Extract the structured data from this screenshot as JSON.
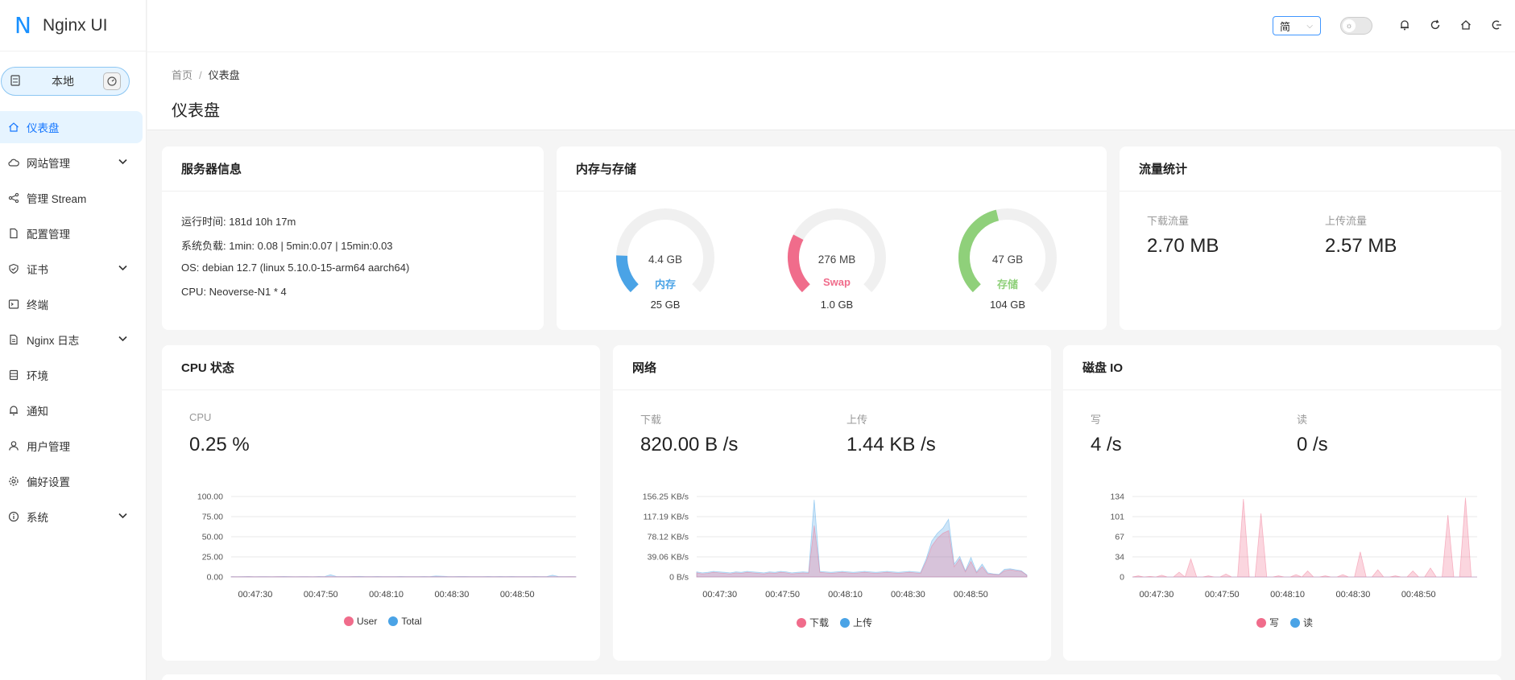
{
  "app": {
    "logo_mark": "N",
    "title": "Nginx UI"
  },
  "environment": {
    "label": "本地"
  },
  "sidebar": {
    "items": [
      {
        "label": "仪表盘",
        "icon": "home-icon",
        "active": true,
        "expandable": false
      },
      {
        "label": "网站管理",
        "icon": "cloud-icon",
        "active": false,
        "expandable": true
      },
      {
        "label": "管理 Stream",
        "icon": "share-icon",
        "active": false,
        "expandable": false
      },
      {
        "label": "配置管理",
        "icon": "file-icon",
        "active": false,
        "expandable": false
      },
      {
        "label": "证书",
        "icon": "shield-check-icon",
        "active": false,
        "expandable": true
      },
      {
        "label": "终端",
        "icon": "terminal-icon",
        "active": false,
        "expandable": false
      },
      {
        "label": "Nginx 日志",
        "icon": "log-file-icon",
        "active": false,
        "expandable": true
      },
      {
        "label": "环境",
        "icon": "database-icon",
        "active": false,
        "expandable": false
      },
      {
        "label": "通知",
        "icon": "bell-icon",
        "active": false,
        "expandable": false
      },
      {
        "label": "用户管理",
        "icon": "user-icon",
        "active": false,
        "expandable": false
      },
      {
        "label": "偏好设置",
        "icon": "gear-icon",
        "active": false,
        "expandable": false
      },
      {
        "label": "系统",
        "icon": "info-circle-icon",
        "active": false,
        "expandable": true
      }
    ]
  },
  "topbar": {
    "language": "简"
  },
  "breadcrumb": {
    "home": "首页",
    "separator": "/",
    "current": "仪表盘"
  },
  "page": {
    "title": "仪表盘"
  },
  "server_info": {
    "title": "服务器信息",
    "uptime": "运行时间: 181d 10h 17m",
    "load": "系统负载: 1min: 0.08 | 5min:0.07 | 15min:0.03",
    "os": "OS: debian 12.7 (linux 5.10.0-15-arm64 aarch64)",
    "cpu": "CPU: Neoverse-N1 * 4"
  },
  "memory_storage": {
    "title": "内存与存储",
    "gauges": [
      {
        "value": "4.4 GB",
        "name": "内存",
        "total": "25 GB",
        "fraction": 0.176,
        "color": "#4aa3e6"
      },
      {
        "value": "276 MB",
        "name": "Swap",
        "total": "1.0 GB",
        "fraction": 0.27,
        "color": "#f06c8b"
      },
      {
        "value": "47 GB",
        "name": "存储",
        "total": "104 GB",
        "fraction": 0.45,
        "color": "#8fd07a"
      }
    ]
  },
  "traffic": {
    "title": "流量统计",
    "download_label": "下载流量",
    "download_value": "2.70 MB",
    "upload_label": "上传流量",
    "upload_value": "2.57 MB"
  },
  "cpu_card": {
    "title": "CPU 状态",
    "label": "CPU",
    "value": "0.25 %"
  },
  "network_card": {
    "title": "网络",
    "down_label": "下载",
    "down_value": "820.00 B /s",
    "up_label": "上传",
    "up_value": "1.44 KB /s"
  },
  "disk_card": {
    "title": "磁盘 IO",
    "write_label": "写",
    "write_value": "4 /s",
    "read_label": "读",
    "read_value": "0 /s"
  },
  "colors": {
    "red_series": "#f06c8b",
    "blue_series": "#4aa3e6",
    "accent": "#1677ff"
  },
  "chart_data": [
    {
      "type": "area",
      "chart": "cpu",
      "x_ticks": [
        "00:47:30",
        "00:47:50",
        "00:48:10",
        "00:48:30",
        "00:48:50"
      ],
      "y_ticks": [
        "100.00",
        "75.00",
        "50.00",
        "25.00",
        "0.00"
      ],
      "ylim": [
        0,
        100
      ],
      "series": [
        {
          "name": "User",
          "color": "#f06c8b",
          "values": [
            0.2,
            0.2,
            0.2,
            0.3,
            0.2,
            0.2,
            0.2,
            0.2,
            0.3,
            0.2,
            0.2,
            0.2,
            0.2,
            0.2,
            0.2,
            0.2,
            0.2,
            0.3,
            0.2,
            0.2,
            0.2,
            0.3,
            0.2,
            0.2,
            0.2,
            0.2,
            0.2,
            0.2,
            0.2,
            0.2,
            0.2,
            0.2,
            0.2,
            0.2,
            0.2,
            0.2,
            0.2,
            0.2,
            0.2,
            0.2,
            0.2,
            0.2,
            0.2,
            0.2,
            0.2,
            0.2,
            0.2,
            0.2,
            0.2,
            0.2,
            0.2,
            0.2,
            0.2,
            0.2,
            0.2,
            0.2,
            0.2,
            0.2,
            0.3,
            0.2
          ]
        },
        {
          "name": "Total",
          "color": "#4aa3e6",
          "values": [
            0.5,
            0.4,
            0.5,
            0.6,
            0.4,
            0.5,
            0.5,
            0.4,
            0.5,
            0.6,
            0.5,
            0.4,
            0.5,
            0.5,
            0.4,
            0.6,
            0.5,
            2.8,
            0.6,
            0.5,
            0.5,
            0.6,
            0.7,
            0.5,
            0.5,
            0.6,
            0.5,
            0.5,
            0.5,
            0.6,
            0.5,
            0.5,
            0.5,
            0.6,
            0.5,
            1.2,
            1.0,
            0.6,
            0.5,
            0.6,
            0.6,
            0.5,
            0.5,
            0.5,
            0.6,
            0.5,
            0.6,
            0.5,
            0.6,
            0.5,
            0.5,
            0.5,
            0.6,
            0.5,
            0.5,
            2.2,
            0.6,
            0.5,
            0.5,
            0.5
          ]
        }
      ]
    },
    {
      "type": "area",
      "chart": "network",
      "x_ticks": [
        "00:47:30",
        "00:47:50",
        "00:48:10",
        "00:48:30",
        "00:48:50"
      ],
      "y_ticks": [
        "156.25 KB/s",
        "117.19 KB/s",
        "78.12 KB/s",
        "39.06 KB/s",
        "0 B/s"
      ],
      "ylim": [
        0,
        156.25
      ],
      "series": [
        {
          "name": "下载",
          "color": "#f06c8b",
          "values": [
            8,
            6,
            7,
            9,
            8,
            7,
            6,
            8,
            7,
            9,
            8,
            7,
            6,
            8,
            7,
            9,
            8,
            6,
            7,
            8,
            7,
            100,
            9,
            8,
            7,
            8,
            9,
            8,
            7,
            8,
            9,
            8,
            7,
            8,
            9,
            8,
            7,
            8,
            9,
            8,
            7,
            30,
            60,
            75,
            85,
            90,
            20,
            35,
            10,
            30,
            8,
            20,
            6,
            5,
            4,
            12,
            14,
            12,
            11,
            3
          ]
        },
        {
          "name": "上传",
          "color": "#4aa3e6",
          "values": [
            10,
            8,
            9,
            11,
            10,
            9,
            8,
            10,
            9,
            11,
            10,
            9,
            8,
            10,
            9,
            11,
            10,
            8,
            9,
            10,
            9,
            150,
            11,
            10,
            9,
            10,
            11,
            10,
            9,
            10,
            11,
            10,
            9,
            10,
            11,
            10,
            9,
            10,
            11,
            10,
            9,
            35,
            70,
            85,
            95,
            112,
            25,
            40,
            12,
            38,
            10,
            25,
            8,
            6,
            5,
            15,
            16,
            14,
            12,
            4
          ]
        }
      ]
    },
    {
      "type": "area",
      "chart": "disk_io",
      "x_ticks": [
        "00:47:30",
        "00:47:50",
        "00:48:10",
        "00:48:30",
        "00:48:50"
      ],
      "y_ticks": [
        "134",
        "101",
        "67",
        "34",
        "0"
      ],
      "ylim": [
        0,
        134
      ],
      "series": [
        {
          "name": "写",
          "color": "#f06c8b",
          "values": [
            0,
            2,
            0,
            1,
            0,
            3,
            0,
            0,
            8,
            0,
            30,
            0,
            0,
            2,
            0,
            0,
            5,
            0,
            0,
            130,
            0,
            0,
            106,
            0,
            0,
            2,
            0,
            0,
            4,
            0,
            10,
            0,
            0,
            2,
            0,
            0,
            4,
            0,
            0,
            42,
            0,
            0,
            12,
            0,
            0,
            2,
            0,
            0,
            10,
            0,
            0,
            15,
            0,
            0,
            103,
            0,
            0,
            132,
            0,
            0
          ]
        },
        {
          "name": "读",
          "color": "#4aa3e6",
          "values": [
            0,
            0,
            0,
            0,
            0,
            0,
            0,
            0,
            0,
            0,
            0,
            0,
            0,
            0,
            0,
            0,
            0,
            0,
            0,
            0,
            0,
            0,
            0,
            0,
            0,
            0,
            0,
            0,
            0,
            0,
            0,
            0,
            0,
            0,
            0,
            0,
            0,
            0,
            0,
            0,
            0,
            0,
            0,
            0,
            0,
            0,
            0,
            0,
            0,
            0,
            0,
            0,
            0,
            0,
            0,
            0,
            0,
            0,
            0,
            0
          ]
        }
      ]
    }
  ]
}
